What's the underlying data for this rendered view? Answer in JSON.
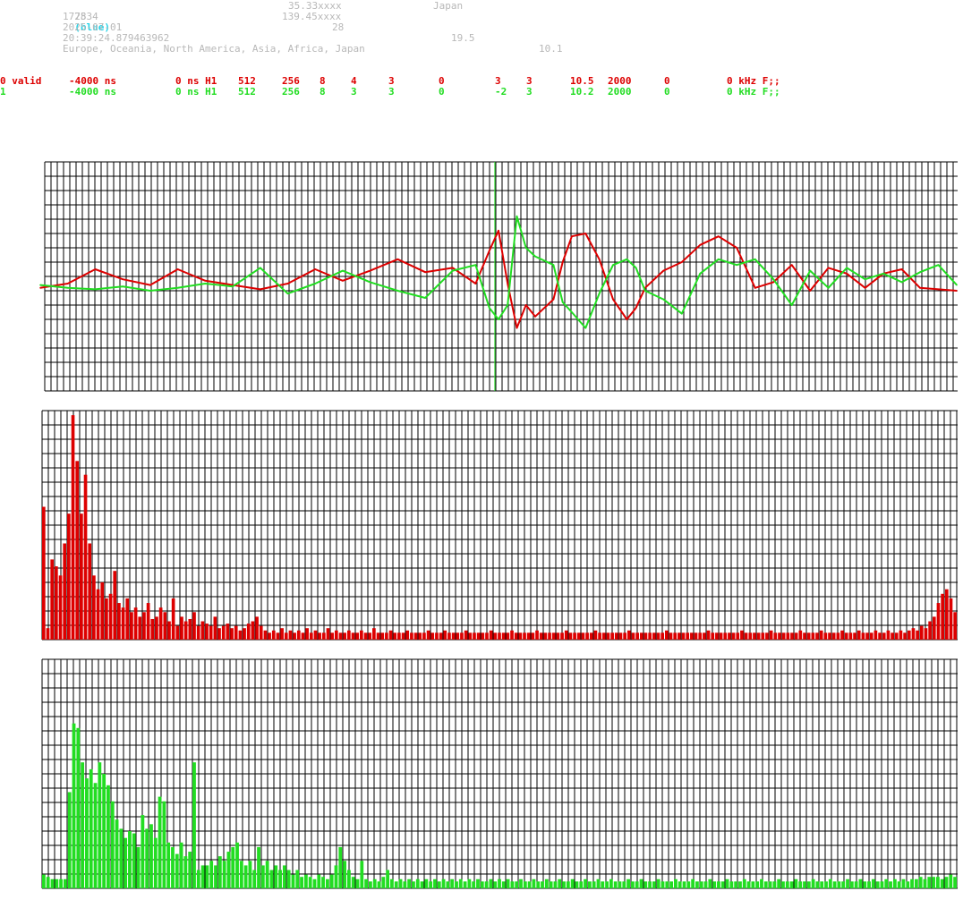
{
  "header": {
    "line1": {
      "station": "2534",
      "color_label": "(blue)",
      "lat": "35.33xxxx",
      "country": "Japan"
    },
    "line2": {
      "id": "1778",
      "lon": "139.45xxxx"
    },
    "line3": {
      "date": "2025-07-01",
      "value": "28"
    },
    "line4": {
      "time": "20:39:24.879463962",
      "value": "19.5"
    },
    "line5": {
      "regions": "Europe, Oceania, North America, Asia, Africa, Japan",
      "value": "10.1"
    }
  },
  "channels": [
    {
      "color": "#dd0000",
      "fields": [
        "0 valid",
        "-4000 ns",
        "0 ns H1",
        "512",
        "256",
        "8",
        "4",
        "3",
        "0",
        "3",
        "3",
        "10.5",
        "2000",
        "0",
        "0 kHz F;;"
      ]
    },
    {
      "color": "#22dd22",
      "fields": [
        "1",
        "-4000 ns",
        "0 ns H1",
        "512",
        "256",
        "8",
        "3",
        "3",
        "0",
        "-2",
        "3",
        "10.2",
        "2000",
        "0",
        "0 kHz F;;"
      ]
    }
  ],
  "colors": {
    "channel0": "#dd0000",
    "channel1": "#22dd22",
    "grid": "#000000",
    "marker": "#22dd22"
  },
  "chart_data": [
    {
      "type": "line",
      "title": "",
      "grid": true,
      "ylim": [
        -8,
        8
      ],
      "marker_x": 0.496,
      "series": [
        {
          "color": "#dd0000",
          "x": [
            0.0,
            0.03,
            0.06,
            0.09,
            0.12,
            0.15,
            0.18,
            0.21,
            0.24,
            0.27,
            0.3,
            0.33,
            0.36,
            0.39,
            0.42,
            0.45,
            0.475,
            0.49,
            0.5,
            0.51,
            0.52,
            0.53,
            0.54,
            0.56,
            0.57,
            0.58,
            0.595,
            0.61,
            0.625,
            0.64,
            0.65,
            0.66,
            0.68,
            0.7,
            0.72,
            0.74,
            0.76,
            0.78,
            0.8,
            0.82,
            0.84,
            0.86,
            0.88,
            0.9,
            0.92,
            0.94,
            0.96,
            0.98,
            1.0
          ],
          "y": [
            -0.8,
            -0.5,
            0.5,
            -0.2,
            -0.6,
            0.5,
            -0.3,
            -0.6,
            -0.9,
            -0.5,
            0.5,
            -0.3,
            0.4,
            1.2,
            0.3,
            0.6,
            -0.5,
            1.8,
            3.2,
            -0.5,
            -3.6,
            -2.0,
            -2.8,
            -1.6,
            1.0,
            2.8,
            3.0,
            1.2,
            -1.6,
            -3.0,
            -2.2,
            -0.8,
            0.4,
            1.0,
            2.2,
            2.8,
            2.0,
            -0.8,
            -0.4,
            0.8,
            -1.0,
            0.6,
            0.2,
            -0.8,
            0.2,
            0.5,
            -0.8,
            -0.9,
            -1.0
          ]
        },
        {
          "color": "#22dd22",
          "x": [
            0.0,
            0.03,
            0.06,
            0.09,
            0.12,
            0.15,
            0.18,
            0.21,
            0.24,
            0.27,
            0.3,
            0.33,
            0.36,
            0.39,
            0.42,
            0.45,
            0.475,
            0.49,
            0.5,
            0.51,
            0.52,
            0.53,
            0.54,
            0.56,
            0.57,
            0.58,
            0.595,
            0.61,
            0.625,
            0.64,
            0.65,
            0.66,
            0.68,
            0.7,
            0.72,
            0.74,
            0.76,
            0.78,
            0.8,
            0.82,
            0.84,
            0.86,
            0.88,
            0.9,
            0.92,
            0.94,
            0.96,
            0.98,
            1.0
          ],
          "y": [
            -0.6,
            -0.8,
            -0.9,
            -0.7,
            -1.0,
            -0.8,
            -0.5,
            -0.7,
            0.6,
            -1.2,
            -0.5,
            0.4,
            -0.4,
            -1.0,
            -1.5,
            0.4,
            0.8,
            -2.2,
            -3.0,
            -2.0,
            4.2,
            2.0,
            1.4,
            0.8,
            -1.8,
            -2.5,
            -3.6,
            -1.2,
            0.8,
            1.2,
            0.6,
            -1.0,
            -1.6,
            -2.6,
            0.2,
            1.2,
            0.8,
            1.2,
            -0.2,
            -2.0,
            0.4,
            -0.8,
            0.6,
            -0.2,
            0.2,
            -0.4,
            0.3,
            0.8,
            -0.6
          ]
        }
      ]
    },
    {
      "type": "bar",
      "title": "",
      "grid": true,
      "ylim": [
        0,
        1
      ],
      "color": "#dd0000",
      "values": [
        0.58,
        0.05,
        0.35,
        0.32,
        0.28,
        0.42,
        0.55,
        0.98,
        0.78,
        0.55,
        0.72,
        0.42,
        0.28,
        0.22,
        0.25,
        0.18,
        0.2,
        0.3,
        0.16,
        0.14,
        0.18,
        0.12,
        0.14,
        0.1,
        0.12,
        0.16,
        0.09,
        0.1,
        0.14,
        0.12,
        0.08,
        0.18,
        0.06,
        0.1,
        0.08,
        0.09,
        0.12,
        0.06,
        0.08,
        0.07,
        0.06,
        0.1,
        0.05,
        0.06,
        0.07,
        0.05,
        0.06,
        0.04,
        0.05,
        0.07,
        0.08,
        0.1,
        0.06,
        0.04,
        0.03,
        0.04,
        0.03,
        0.05,
        0.03,
        0.04,
        0.03,
        0.04,
        0.03,
        0.05,
        0.03,
        0.04,
        0.03,
        0.03,
        0.05,
        0.03,
        0.04,
        0.03,
        0.03,
        0.04,
        0.03,
        0.03,
        0.04,
        0.03,
        0.03,
        0.05,
        0.03,
        0.03,
        0.03,
        0.04,
        0.03,
        0.03,
        0.03,
        0.04,
        0.03,
        0.03,
        0.03,
        0.03,
        0.04,
        0.03,
        0.03,
        0.03,
        0.04,
        0.03,
        0.03,
        0.03,
        0.03,
        0.04,
        0.03,
        0.03,
        0.03,
        0.03,
        0.03,
        0.04,
        0.03,
        0.03,
        0.03,
        0.03,
        0.04,
        0.03,
        0.03,
        0.03,
        0.03,
        0.03,
        0.04,
        0.03,
        0.03,
        0.03,
        0.03,
        0.03,
        0.03,
        0.04,
        0.03,
        0.03,
        0.03,
        0.03,
        0.03,
        0.03,
        0.04,
        0.03,
        0.03,
        0.03,
        0.03,
        0.03,
        0.03,
        0.03,
        0.04,
        0.03,
        0.03,
        0.03,
        0.03,
        0.03,
        0.03,
        0.03,
        0.03,
        0.04,
        0.03,
        0.03,
        0.03,
        0.03,
        0.03,
        0.03,
        0.03,
        0.03,
        0.03,
        0.04,
        0.03,
        0.03,
        0.03,
        0.03,
        0.03,
        0.03,
        0.03,
        0.04,
        0.03,
        0.03,
        0.03,
        0.03,
        0.03,
        0.03,
        0.04,
        0.03,
        0.03,
        0.03,
        0.03,
        0.03,
        0.03,
        0.04,
        0.03,
        0.03,
        0.03,
        0.03,
        0.04,
        0.03,
        0.03,
        0.03,
        0.03,
        0.04,
        0.03,
        0.03,
        0.03,
        0.04,
        0.03,
        0.03,
        0.03,
        0.04,
        0.03,
        0.03,
        0.04,
        0.03,
        0.03,
        0.04,
        0.03,
        0.04,
        0.05,
        0.04,
        0.06,
        0.05,
        0.08,
        0.1,
        0.16,
        0.2,
        0.22,
        0.18,
        0.12
      ]
    },
    {
      "type": "bar",
      "title": "",
      "grid": true,
      "ylim": [
        0,
        1
      ],
      "color": "#22dd22",
      "values": [
        0.06,
        0.05,
        0.04,
        0.04,
        0.04,
        0.04,
        0.42,
        0.72,
        0.7,
        0.55,
        0.48,
        0.52,
        0.46,
        0.55,
        0.5,
        0.45,
        0.38,
        0.3,
        0.26,
        0.22,
        0.25,
        0.24,
        0.18,
        0.32,
        0.26,
        0.28,
        0.22,
        0.4,
        0.38,
        0.2,
        0.18,
        0.15,
        0.2,
        0.14,
        0.16,
        0.55,
        0.08,
        0.1,
        0.1,
        0.12,
        0.1,
        0.14,
        0.12,
        0.16,
        0.18,
        0.2,
        0.12,
        0.1,
        0.12,
        0.08,
        0.18,
        0.1,
        0.12,
        0.08,
        0.1,
        0.08,
        0.1,
        0.08,
        0.06,
        0.08,
        0.05,
        0.06,
        0.05,
        0.04,
        0.06,
        0.05,
        0.04,
        0.06,
        0.1,
        0.18,
        0.12,
        0.08,
        0.05,
        0.04,
        0.12,
        0.04,
        0.03,
        0.04,
        0.03,
        0.05,
        0.08,
        0.04,
        0.03,
        0.04,
        0.03,
        0.04,
        0.03,
        0.04,
        0.03,
        0.04,
        0.03,
        0.04,
        0.03,
        0.04,
        0.03,
        0.04,
        0.03,
        0.04,
        0.03,
        0.04,
        0.03,
        0.04,
        0.03,
        0.03,
        0.04,
        0.03,
        0.04,
        0.03,
        0.04,
        0.03,
        0.03,
        0.04,
        0.03,
        0.03,
        0.04,
        0.03,
        0.03,
        0.04,
        0.03,
        0.03,
        0.04,
        0.03,
        0.03,
        0.04,
        0.03,
        0.03,
        0.04,
        0.03,
        0.03,
        0.04,
        0.03,
        0.03,
        0.04,
        0.03,
        0.03,
        0.03,
        0.04,
        0.03,
        0.03,
        0.04,
        0.03,
        0.03,
        0.03,
        0.04,
        0.03,
        0.03,
        0.03,
        0.04,
        0.03,
        0.03,
        0.03,
        0.04,
        0.03,
        0.03,
        0.03,
        0.04,
        0.03,
        0.03,
        0.03,
        0.04,
        0.03,
        0.03,
        0.03,
        0.04,
        0.03,
        0.03,
        0.03,
        0.04,
        0.03,
        0.03,
        0.03,
        0.04,
        0.03,
        0.03,
        0.03,
        0.04,
        0.03,
        0.03,
        0.03,
        0.04,
        0.03,
        0.03,
        0.03,
        0.04,
        0.03,
        0.03,
        0.03,
        0.04,
        0.03,
        0.03,
        0.04,
        0.03,
        0.03,
        0.04,
        0.03,
        0.03,
        0.04,
        0.03,
        0.04,
        0.03,
        0.04,
        0.03,
        0.04,
        0.04,
        0.05,
        0.04,
        0.05,
        0.05,
        0.05,
        0.04,
        0.05,
        0.06,
        0.05
      ]
    }
  ]
}
